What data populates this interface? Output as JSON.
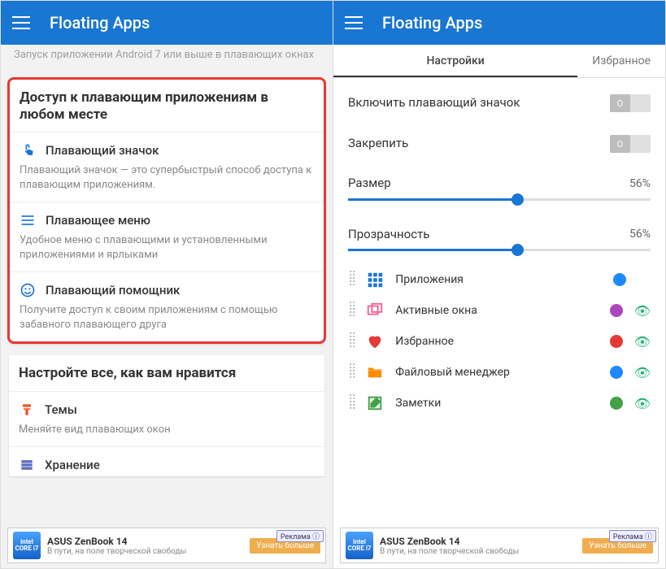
{
  "header": {
    "title": "Floating Apps"
  },
  "left": {
    "top_note": "Запуск приложении Android 7 или выше в плавающих окнах",
    "access": {
      "title": "Доступ к плавающим приложениям в любом месте",
      "items": [
        {
          "label": "Плавающий значок",
          "desc": "Плавающий значок — это супербыстрый способ доступа к плавающим приложениям.",
          "icon": "touch"
        },
        {
          "label": "Плавающее меню",
          "desc": "Удобное меню с плавающими и установленными приложениями и ярлыками",
          "icon": "menu-lines"
        },
        {
          "label": "Плавающий помощник",
          "desc": "Получите доступ к своим приложениям с помощью забавного плавающего друга",
          "icon": "face"
        }
      ]
    },
    "customize": {
      "title": "Настройте все, как вам нравится",
      "items": [
        {
          "label": "Темы",
          "desc": "Меняйте вид плавающих окон",
          "icon": "paint"
        },
        {
          "label": "Хранение",
          "desc": "",
          "icon": "storage"
        }
      ]
    }
  },
  "right": {
    "tabs": {
      "settings": "Настройки",
      "favorites": "Избранное"
    },
    "toggles": {
      "enable_icon": {
        "label": "Включить плавающий значок",
        "state": "O"
      },
      "pin": {
        "label": "Закрепить",
        "state": "O"
      }
    },
    "sliders": {
      "size": {
        "label": "Размер",
        "value": "56%",
        "pct": 56
      },
      "opacity": {
        "label": "Прозрачность",
        "value": "56%",
        "pct": 56
      }
    },
    "items": [
      {
        "label": "Приложения",
        "icon": "grid",
        "icon_color": "#1976d2",
        "dot": "#1e88ff",
        "eye": false
      },
      {
        "label": "Активные окна",
        "icon": "windows",
        "icon_color": "#f06292",
        "dot": "#ab47bc",
        "eye": true
      },
      {
        "label": "Избранное",
        "icon": "heart",
        "icon_color": "#e53935",
        "dot": "#e53935",
        "eye": true
      },
      {
        "label": "Файловый менеджер",
        "icon": "folder",
        "icon_color": "#fb8c00",
        "dot": "#1e88ff",
        "eye": true
      },
      {
        "label": "Заметки",
        "icon": "note",
        "icon_color": "#43a047",
        "dot": "#43a047",
        "eye": true
      }
    ]
  },
  "ad": {
    "chip": "intel CORE i7",
    "title": "ASUS ZenBook 14",
    "sub": "В пути, на поле творческой свободы",
    "tag": "Реклама ⓘ",
    "btn": "Узнать больше"
  }
}
